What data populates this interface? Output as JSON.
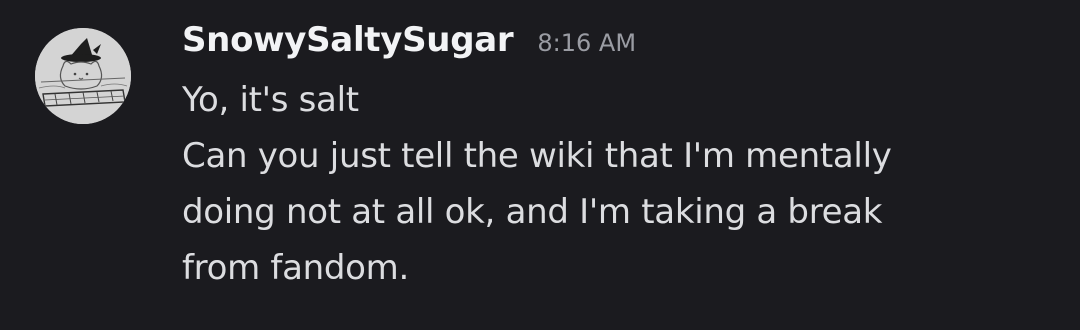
{
  "message": {
    "author": "SnowySaltySugar",
    "timestamp": "8:16 AM",
    "avatar_icon": "hand-drawn-cat-with-witch-hat",
    "lines": [
      "Yo, it's salt",
      "Can you just tell the wiki that I'm mentally",
      "doing not at all ok, and I'm taking a break",
      "from fandom."
    ]
  },
  "colors": {
    "background": "#1b1b1f",
    "username": "#f2f3f5",
    "timestamp": "#9a9ca3",
    "text": "#dcdde0"
  }
}
